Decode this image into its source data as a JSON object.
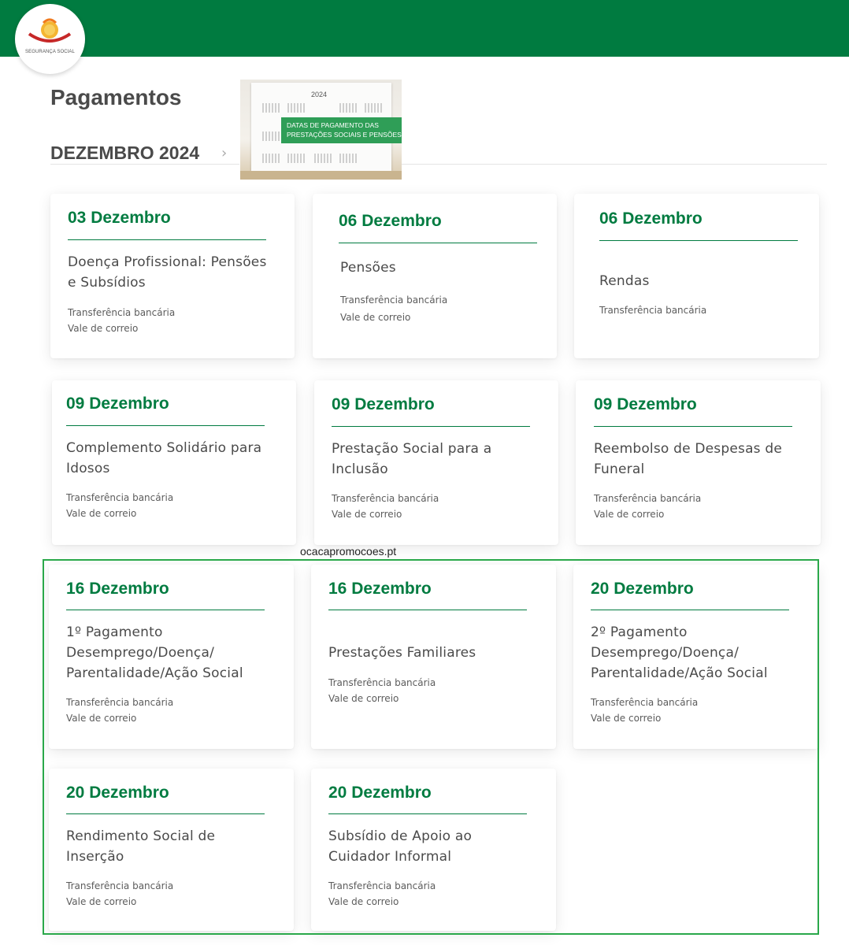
{
  "header": {
    "logo_text": "SEGURANÇA SOCIAL",
    "brand_color": "#007b40"
  },
  "page": {
    "title": "Pagamentos",
    "month": "DEZEMBRO 2024",
    "month_nav_icon": "chevron-right-icon"
  },
  "banner": {
    "year": "2024",
    "caption_line1": "DATAS DE PAGAMENTO DAS",
    "caption_line2": "PRESTAÇÕES SOCIAIS E PENSÕES"
  },
  "watermark": "ocacapromocoes.pt",
  "cards": [
    {
      "date": "03 Dezembro",
      "title": "Doença Profissional: Pensões e Subsídios",
      "methods": [
        "Transferência bancária",
        "Vale de correio"
      ]
    },
    {
      "date": "06 Dezembro",
      "title": "Pensões",
      "methods": [
        "Transferência bancária",
        "Vale de correio"
      ]
    },
    {
      "date": "06 Dezembro",
      "title": "Rendas",
      "methods": [
        "Transferência bancária"
      ]
    },
    {
      "date": "09 Dezembro",
      "title": "Complemento Solidário para Idosos",
      "methods": [
        "Transferência bancária",
        "Vale de correio"
      ]
    },
    {
      "date": "09 Dezembro",
      "title": "Prestação Social para a Inclusão",
      "methods": [
        "Transferência bancária",
        "Vale de correio"
      ]
    },
    {
      "date": "09 Dezembro",
      "title": "Reembolso de Despesas de Funeral",
      "methods": [
        "Transferência bancária",
        "Vale de correio"
      ]
    },
    {
      "date": "16 Dezembro",
      "title": "1º Pagamento Desemprego/Doença/ Parentalidade/Ação Social",
      "methods": [
        "Transferência bancária",
        "Vale de correio"
      ]
    },
    {
      "date": "16 Dezembro",
      "title": "Prestações Familiares",
      "methods": [
        "Transferência bancária",
        "Vale de correio"
      ]
    },
    {
      "date": "20 Dezembro",
      "title": "2º Pagamento Desemprego/Doença/ Parentalidade/Ação Social",
      "methods": [
        "Transferência bancária",
        "Vale de correio"
      ]
    },
    {
      "date": "20 Dezembro",
      "title": "Rendimento Social de Inserção",
      "methods": [
        "Transferência bancária",
        "Vale de correio"
      ]
    },
    {
      "date": "20 Dezembro",
      "title": "Subsídio de Apoio ao Cuidador Informal",
      "methods": [
        "Transferência bancária",
        "Vale de correio"
      ]
    }
  ]
}
